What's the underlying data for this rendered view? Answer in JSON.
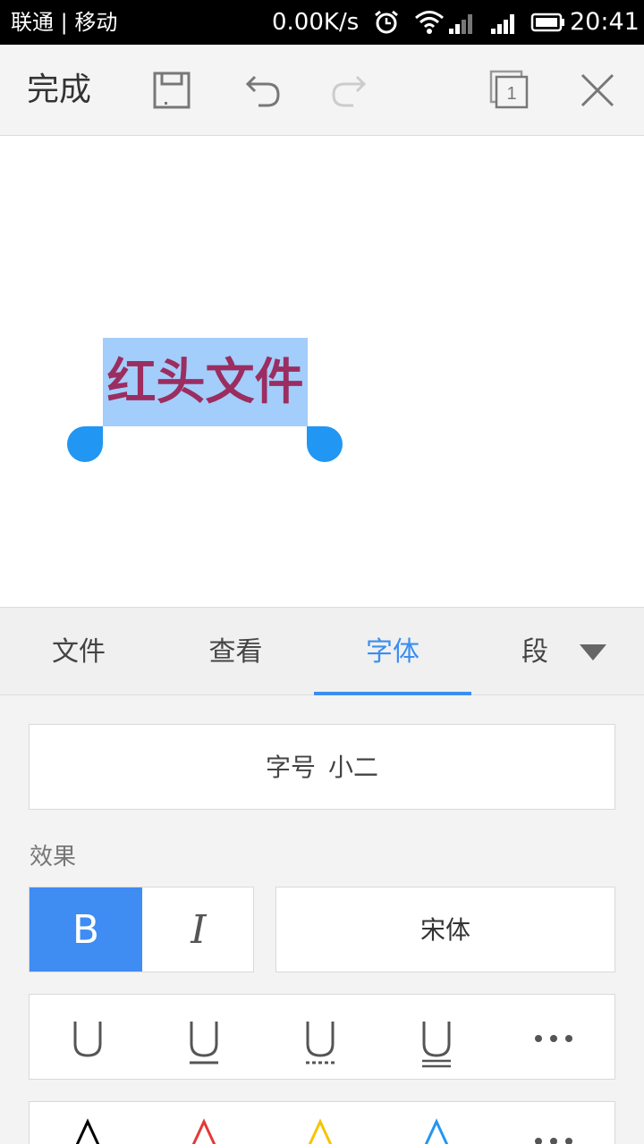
{
  "status_bar": {
    "carrier": "联通 | 移动",
    "network_speed": "0.00K/s",
    "time": "20:41"
  },
  "toolbar": {
    "done_label": "完成",
    "page_count": "1"
  },
  "document": {
    "selected_text": "红头文件",
    "text_color": "#9b2d60",
    "selection_color": "#a3cdfb"
  },
  "tabs": [
    {
      "label": "文件",
      "active": false
    },
    {
      "label": "查看",
      "active": false
    },
    {
      "label": "字体",
      "active": true
    },
    {
      "label": "段",
      "active": false
    }
  ],
  "panel": {
    "font_size_label": "字号",
    "font_size_value": "小二",
    "effects_label": "效果",
    "bold_label": "B",
    "italic_label": "I",
    "bold_active": true,
    "font_face": "宋体",
    "font_colors": [
      "#000000",
      "#e53935",
      "#f5c400",
      "#2196f3"
    ]
  },
  "colors": {
    "accent": "#3b8ef0"
  }
}
